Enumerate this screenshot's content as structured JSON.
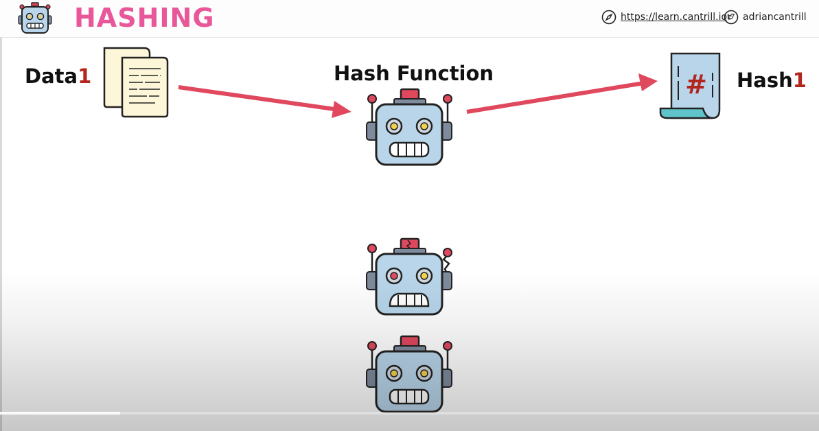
{
  "slide": {
    "title": "HASHING",
    "links": {
      "website": "https://learn.cantrill.io",
      "twitter": "adriancantrill"
    },
    "data_label": {
      "text": "Data",
      "number": "1"
    },
    "hash_label": {
      "text": "Hash",
      "number": "1"
    },
    "function_label": "Hash Function",
    "hash_symbol": "#"
  },
  "colors": {
    "title": "#e8579a",
    "accent_number": "#b3261e",
    "arrow": "#e0485e",
    "robot_face": "#b8d5ea",
    "robot_hat": "#e0485e"
  },
  "player": {
    "progress": 0.147
  }
}
